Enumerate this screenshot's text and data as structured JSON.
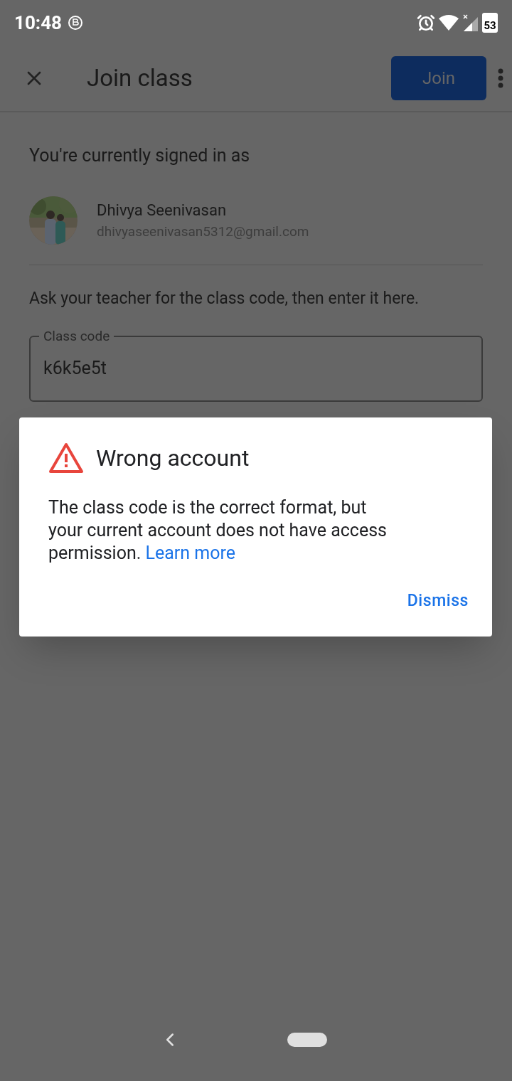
{
  "status_bar": {
    "time": "10:48",
    "battery": "53"
  },
  "toolbar": {
    "title": "Join class",
    "join_button": "Join"
  },
  "signed_in_heading": "You're currently signed in as",
  "account": {
    "name": "Dhivya Seenivasan",
    "email": "dhivyaseenivasan5312@gmail.com"
  },
  "instruction": "Ask your teacher for the class code, then enter it here.",
  "class_code_field": {
    "label": "Class code",
    "value": "k6k5e5t"
  },
  "dialog": {
    "title": "Wrong account",
    "message": "The class code is the correct format, but your current account does not have access permission.",
    "link": "Learn more",
    "button": "Dismiss"
  }
}
